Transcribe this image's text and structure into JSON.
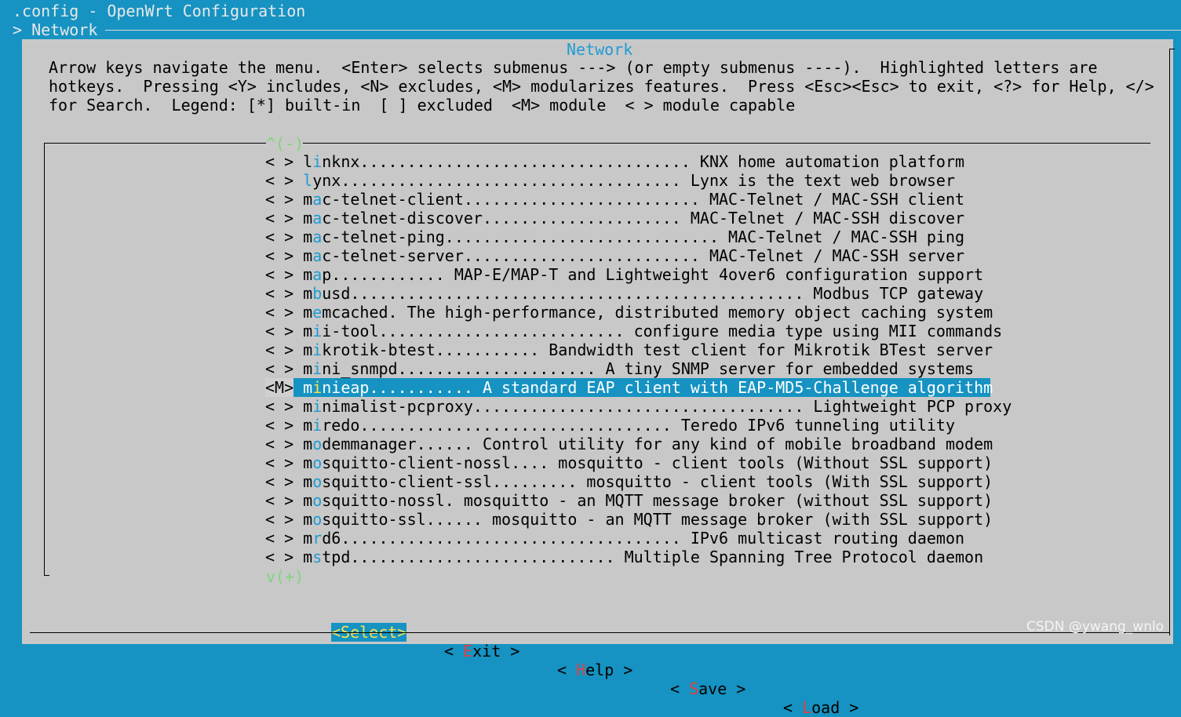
{
  "title": ".config - OpenWrt Configuration",
  "breadcrumb": "> Network",
  "dialog_title": "Network",
  "help": [
    "Arrow keys navigate the menu.  <Enter> selects submenus ---> (or empty submenus ----).  Highlighted letters are",
    "hotkeys.  Pressing <Y> includes, <N> excludes, <M> modularizes features.  Press <Esc><Esc> to exit, <?> for Help, </>",
    "for Search.  Legend: [*] built-in  [ ] excluded  <M> module  < > module capable"
  ],
  "scroll_up": "^(-)",
  "scroll_down": "v(+)",
  "items": [
    {
      "mark": "< >",
      "pre": "l",
      "hk": "i",
      "post": "nknx................................... KNX home automation platform"
    },
    {
      "mark": "< >",
      "pre": "",
      "hk": "l",
      "post": "ynx.................................... Lynx is the text web browser"
    },
    {
      "mark": "< >",
      "pre": "m",
      "hk": "a",
      "post": "c-telnet-client......................... MAC-Telnet / MAC-SSH client"
    },
    {
      "mark": "< >",
      "pre": "m",
      "hk": "a",
      "post": "c-telnet-discover..................... MAC-Telnet / MAC-SSH discover"
    },
    {
      "mark": "< >",
      "pre": "m",
      "hk": "a",
      "post": "c-telnet-ping............................. MAC-Telnet / MAC-SSH ping"
    },
    {
      "mark": "< >",
      "pre": "m",
      "hk": "a",
      "post": "c-telnet-server......................... MAC-Telnet / MAC-SSH server"
    },
    {
      "mark": "< >",
      "pre": "m",
      "hk": "a",
      "post": "p............ MAP-E/MAP-T and Lightweight 4over6 configuration support"
    },
    {
      "mark": "< >",
      "pre": "m",
      "hk": "b",
      "post": "usd................................................ Modbus TCP gateway"
    },
    {
      "mark": "< >",
      "pre": "m",
      "hk": "e",
      "post": "mcached. The high-performance, distributed memory object caching system"
    },
    {
      "mark": "< >",
      "pre": "m",
      "hk": "i",
      "post": "i-tool.......................... configure media type using MII commands"
    },
    {
      "mark": "< >",
      "pre": "m",
      "hk": "i",
      "post": "krotik-btest........... Bandwidth test client for Mikrotik BTest server"
    },
    {
      "mark": "< >",
      "pre": "m",
      "hk": "i",
      "post": "ni_snmpd..................... A tiny SNMP server for embedded systems"
    },
    {
      "mark": "<M>",
      "pre": "m",
      "hk": "i",
      "post": "nieap........... A standard EAP client with EAP-MD5-Challenge algorithm",
      "selected": true
    },
    {
      "mark": "< >",
      "pre": "m",
      "hk": "i",
      "post": "nimalist-pcproxy................................... Lightweight PCP proxy"
    },
    {
      "mark": "< >",
      "pre": "m",
      "hk": "i",
      "post": "redo................................. Teredo IPv6 tunneling utility"
    },
    {
      "mark": "< >",
      "pre": "m",
      "hk": "o",
      "post": "demmanager...... Control utility for any kind of mobile broadband modem"
    },
    {
      "mark": "< >",
      "pre": "m",
      "hk": "o",
      "post": "squitto-client-nossl.... mosquitto - client tools (Without SSL support)"
    },
    {
      "mark": "< >",
      "pre": "m",
      "hk": "o",
      "post": "squitto-client-ssl......... mosquitto - client tools (With SSL support)"
    },
    {
      "mark": "< >",
      "pre": "m",
      "hk": "o",
      "post": "squitto-nossl. mosquitto - an MQTT message broker (without SSL support)"
    },
    {
      "mark": "< >",
      "pre": "m",
      "hk": "o",
      "post": "squitto-ssl...... mosquitto - an MQTT message broker (with SSL support)"
    },
    {
      "mark": "< >",
      "pre": "m",
      "hk": "r",
      "post": "d6.................................... IPv6 multicast routing daemon"
    },
    {
      "mark": "< >",
      "pre": "m",
      "hk": "s",
      "post": "tpd............................ Multiple Spanning Tree Protocol daemon"
    }
  ],
  "buttons": {
    "select": "<Select>",
    "exit": {
      "pre": "< ",
      "hk": "E",
      "post": "xit >"
    },
    "help": {
      "pre": "< ",
      "hk": "H",
      "post": "elp >"
    },
    "save": {
      "pre": "< ",
      "hk": "S",
      "post": "ave >"
    },
    "load": {
      "pre": "< ",
      "hk": "L",
      "post": "oad >"
    }
  },
  "watermark": "CSDN @ywang_wnlo",
  "colors": {
    "background": "#1693c2",
    "dialog": "#c8c8c8",
    "hotkey": "#1f9bd2",
    "button_hotkey": "#e04040",
    "selected_hotkey": "#ffe24a"
  }
}
